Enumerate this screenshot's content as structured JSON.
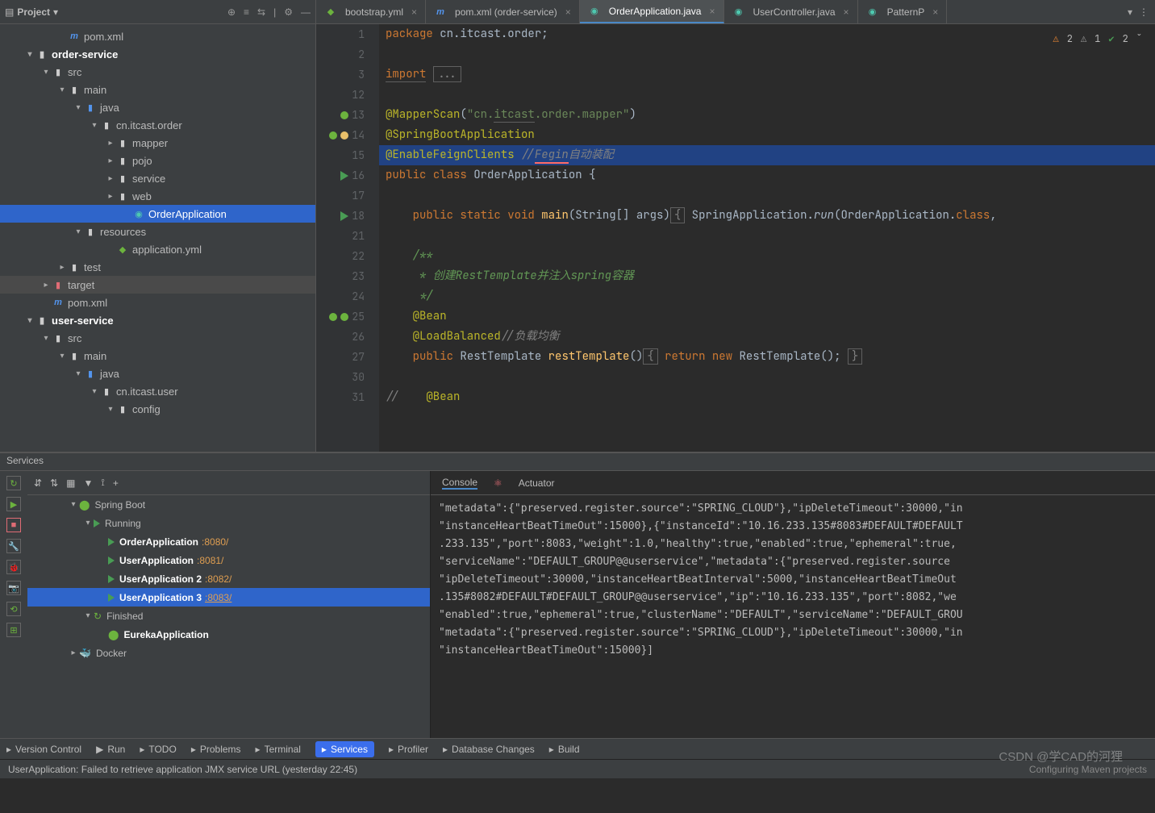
{
  "project": {
    "label": "Project",
    "tree": [
      {
        "indent": 70,
        "tw": "",
        "icon": "m",
        "text": "pom.xml"
      },
      {
        "indent": 30,
        "tw": "▾",
        "icon": "fo",
        "text": "order-service",
        "bold": true
      },
      {
        "indent": 50,
        "tw": "▾",
        "icon": "fo",
        "text": "src"
      },
      {
        "indent": 70,
        "tw": "▾",
        "icon": "fo",
        "text": "main"
      },
      {
        "indent": 90,
        "tw": "▾",
        "icon": "fo-blue",
        "text": "java"
      },
      {
        "indent": 110,
        "tw": "▾",
        "icon": "fo",
        "text": "cn.itcast.order"
      },
      {
        "indent": 130,
        "tw": "▸",
        "icon": "fo",
        "text": "mapper"
      },
      {
        "indent": 130,
        "tw": "▸",
        "icon": "fo",
        "text": "pojo"
      },
      {
        "indent": 130,
        "tw": "▸",
        "icon": "fo",
        "text": "service"
      },
      {
        "indent": 130,
        "tw": "▸",
        "icon": "fo",
        "text": "web"
      },
      {
        "indent": 150,
        "tw": "",
        "icon": "leaf",
        "text": "OrderApplication",
        "sel": true
      },
      {
        "indent": 90,
        "tw": "▾",
        "icon": "fo",
        "text": "resources"
      },
      {
        "indent": 130,
        "tw": "",
        "icon": "yml",
        "text": "application.yml"
      },
      {
        "indent": 70,
        "tw": "▸",
        "icon": "fo",
        "text": "test"
      },
      {
        "indent": 50,
        "tw": "▸",
        "icon": "fo-red",
        "text": "target",
        "dim": true
      },
      {
        "indent": 50,
        "tw": "",
        "icon": "m",
        "text": "pom.xml"
      },
      {
        "indent": 30,
        "tw": "▾",
        "icon": "fo",
        "text": "user-service",
        "bold": true
      },
      {
        "indent": 50,
        "tw": "▾",
        "icon": "fo",
        "text": "src"
      },
      {
        "indent": 70,
        "tw": "▾",
        "icon": "fo",
        "text": "main"
      },
      {
        "indent": 90,
        "tw": "▾",
        "icon": "fo-blue",
        "text": "java"
      },
      {
        "indent": 110,
        "tw": "▾",
        "icon": "fo",
        "text": "cn.itcast.user"
      },
      {
        "indent": 130,
        "tw": "▾",
        "icon": "fo",
        "text": "config"
      }
    ]
  },
  "tabs": [
    {
      "icon": "yml",
      "label": "bootstrap.yml"
    },
    {
      "icon": "m",
      "label": "pom.xml (order-service)"
    },
    {
      "icon": "leaf",
      "label": "OrderApplication.java",
      "active": true
    },
    {
      "icon": "leaf",
      "label": "UserController.java"
    },
    {
      "icon": "leaf",
      "label": "PatternP"
    }
  ],
  "inspections": {
    "err": "2",
    "warn": "1",
    "ok": "2"
  },
  "gutter": [
    {
      "n": "1"
    },
    {
      "n": "2"
    },
    {
      "n": "3"
    },
    {
      "n": "12"
    },
    {
      "n": "13",
      "ic": [
        "nav"
      ]
    },
    {
      "n": "14",
      "ic": [
        "nav",
        "bulb"
      ]
    },
    {
      "n": "15",
      "ic": [
        "search"
      ]
    },
    {
      "n": "16",
      "ic": [
        "run"
      ]
    },
    {
      "n": "17"
    },
    {
      "n": "18",
      "ic": [
        "run"
      ]
    },
    {
      "n": "21"
    },
    {
      "n": "22"
    },
    {
      "n": "23"
    },
    {
      "n": "24"
    },
    {
      "n": "25",
      "ic": [
        "nav",
        "nav"
      ]
    },
    {
      "n": "26"
    },
    {
      "n": "27"
    },
    {
      "n": "30"
    },
    {
      "n": "31"
    }
  ],
  "code": [
    {
      "html": "<span class='kw'>package</span> <span class='cls'>cn.itcast.order</span>;"
    },
    {
      "html": ""
    },
    {
      "html": "<span class='kw underline-grey'>import</span> <span class='fold'>...</span>"
    },
    {
      "html": ""
    },
    {
      "html": "<span class='ann'>@MapperScan</span>(<span class='str'>\"cn.<span class='underline-grey'>itcast</span>.order.mapper\"</span>)"
    },
    {
      "html": "<span class='ann'>@SpringBootApplication</span>"
    },
    {
      "html": "<span class='ann'>@EnableFeignClients</span> <span class='cmt'>//<span class='underline-red'>Fegin</span>自动装配</span>",
      "hl": true
    },
    {
      "html": "<span class='kw'>public</span> <span class='kw'>class</span> <span class='cls'>OrderApplication</span> {"
    },
    {
      "html": ""
    },
    {
      "html": "    <span class='kw'>public</span> <span class='kw'>static</span> <span class='kw'>void</span> <span class='fn'>main</span>(String[] args)<span class='fold'>{</span> SpringApplication.<span style='font-style:italic'>run</span>(OrderApplication.<span class='kw'>class</span>,"
    },
    {
      "html": ""
    },
    {
      "html": "    <span class='doc'>/**</span>"
    },
    {
      "html": "    <span class='doc'> * 创建RestTemplate并注入spring容器</span>"
    },
    {
      "html": "    <span class='doc'> */</span>"
    },
    {
      "html": "    <span class='ann'>@Bean</span>"
    },
    {
      "html": "    <span class='ann'>@LoadBalanced</span><span class='cmt'>//负载均衡</span>"
    },
    {
      "html": "    <span class='kw'>public</span> <span class='cls'>RestTemplate</span> <span class='fn'>restTemplate</span>()<span class='fold'>{</span> <span class='kw'>return</span> <span class='kw'>new</span> RestTemplate(); <span class='fold'>}</span>"
    },
    {
      "html": ""
    },
    {
      "html": "<span class='cmt'>//    </span><span class='ann'>@Bean</span>"
    }
  ],
  "services": {
    "title": "Services",
    "tree": [
      {
        "i": 10,
        "tw": "▾",
        "ic": "boot",
        "text": "Spring Boot"
      },
      {
        "i": 28,
        "tw": "▾",
        "ic": "run",
        "text": "Running"
      },
      {
        "i": 60,
        "ic": "run",
        "text": "OrderApplication",
        "port": ":8080/",
        "bold": true
      },
      {
        "i": 60,
        "ic": "run",
        "text": "UserApplication",
        "port": ":8081/",
        "bold": true
      },
      {
        "i": 60,
        "ic": "run",
        "text": "UserApplication 2",
        "port": ":8082/",
        "bold": true
      },
      {
        "i": 60,
        "ic": "run",
        "text": "UserApplication 3",
        "port": ":8083/",
        "bold": true,
        "sel": true,
        "u": true
      },
      {
        "i": 28,
        "tw": "▾",
        "ic": "fin",
        "text": "Finished"
      },
      {
        "i": 60,
        "ic": "boot",
        "text": "EurekaApplication",
        "bold": true
      },
      {
        "i": 10,
        "tw": "▸",
        "ic": "docker",
        "text": "Docker"
      }
    ],
    "consoleTabs": {
      "console": "Console",
      "actuator": "Actuator"
    },
    "console": [
      "\"metadata\":{\"preserved.register.source\":\"SPRING_CLOUD\"},\"ipDeleteTimeout\":30000,\"in",
      "\"instanceHeartBeatTimeOut\":15000},{\"instanceId\":\"10.16.233.135#8083#DEFAULT#DEFAULT",
      ".233.135\",\"port\":8083,\"weight\":1.0,\"healthy\":true,\"enabled\":true,\"ephemeral\":true,",
      "\"serviceName\":\"DEFAULT_GROUP@@userservice\",\"metadata\":{\"preserved.register.source",
      "\"ipDeleteTimeout\":30000,\"instanceHeartBeatInterval\":5000,\"instanceHeartBeatTimeOut",
      ".135#8082#DEFAULT#DEFAULT_GROUP@@userservice\",\"ip\":\"10.16.233.135\",\"port\":8082,\"we",
      "\"enabled\":true,\"ephemeral\":true,\"clusterName\":\"DEFAULT\",\"serviceName\":\"DEFAULT_GROU",
      "\"metadata\":{\"preserved.register.source\":\"SPRING_CLOUD\"},\"ipDeleteTimeout\":30000,\"in",
      "\"instanceHeartBeatTimeOut\":15000}]"
    ]
  },
  "bottomBar": [
    {
      "label": "Version Control"
    },
    {
      "label": "Run",
      "ic": "▶"
    },
    {
      "label": "TODO"
    },
    {
      "label": "Problems"
    },
    {
      "label": "Terminal"
    },
    {
      "label": "Services",
      "active": true
    },
    {
      "label": "Profiler"
    },
    {
      "label": "Database Changes"
    },
    {
      "label": "Build"
    }
  ],
  "status": {
    "left": "UserApplication: Failed to retrieve application JMX service URL (yesterday 22:45)",
    "right": "Configuring Maven projects"
  },
  "watermark": "CSDN @学CAD的河狸"
}
